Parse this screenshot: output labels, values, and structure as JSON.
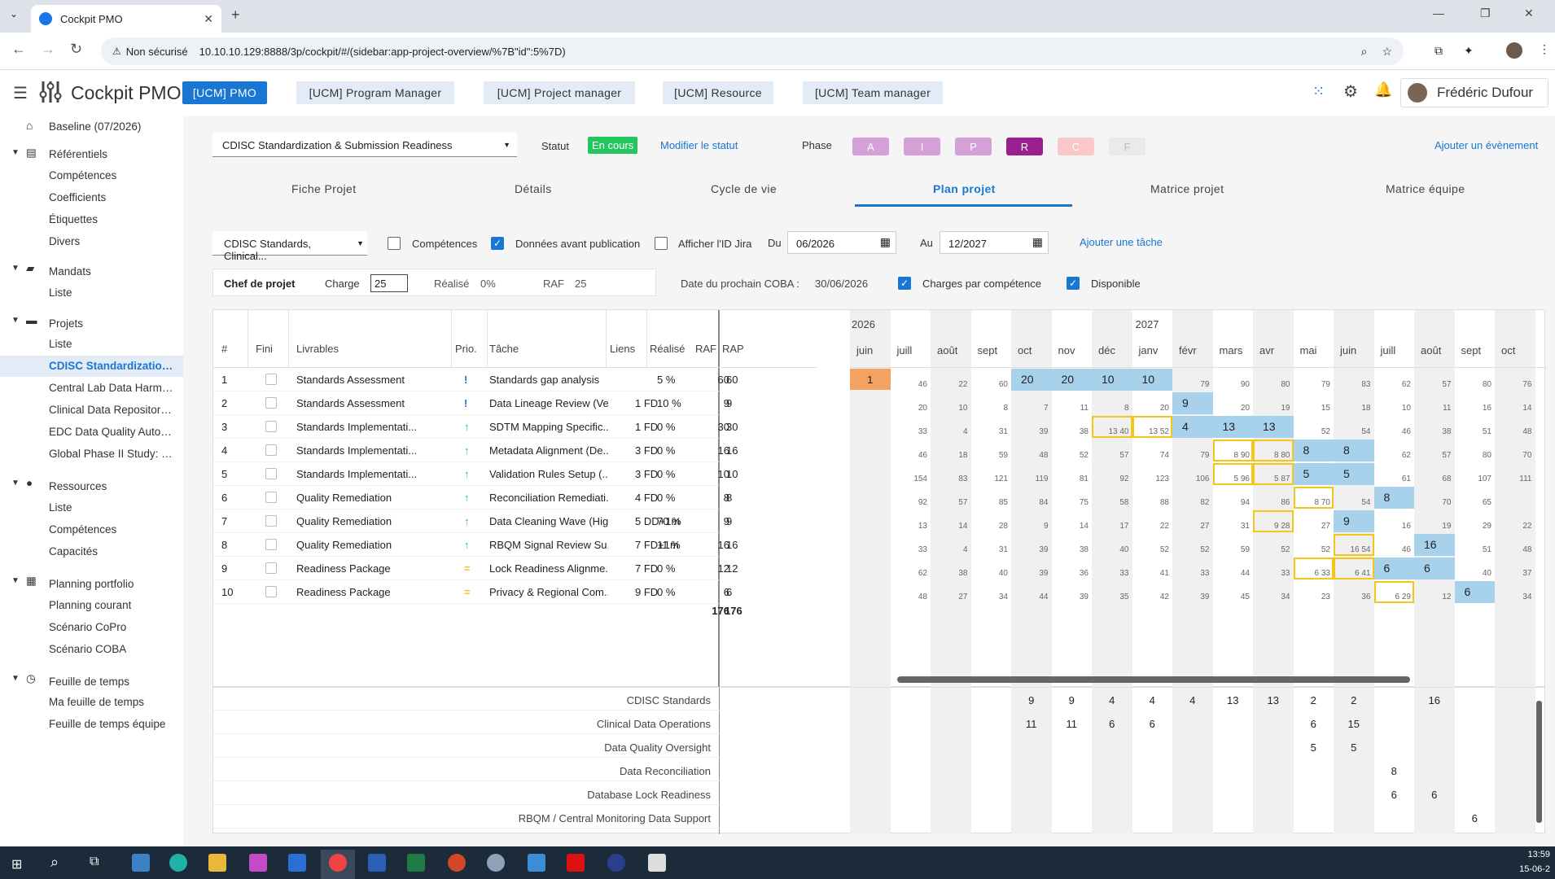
{
  "browser": {
    "tab_title": "Cockpit PMO",
    "security": "Non sécurisé",
    "url": "10.10.10.129:8888/3p/cockpit/#/(sidebar:app-project-overview/%7B\"id\":5%7D)"
  },
  "app": {
    "title": "Cockpit PMO",
    "user": "Frédéric Dufour",
    "roles": [
      "[UCM] PMO",
      "[UCM] Program Manager",
      "[UCM] Project manager",
      "[UCM] Resource",
      "[UCM] Team manager"
    ]
  },
  "sidebar": {
    "baseline": "Baseline (07/2026)",
    "sections": [
      {
        "title": "Référentiels",
        "items": [
          "Compétences",
          "Coefficients",
          "Étiquettes",
          "Divers"
        ]
      },
      {
        "title": "Mandats",
        "items": [
          "Liste"
        ]
      },
      {
        "title": "Projets",
        "items": [
          "Liste",
          "CDISC Standardization ...",
          "Central Lab Data Harmo...",
          "Clinical Data Repository ...",
          "EDC Data Quality Autom...",
          "Global Phase II Study: E..."
        ]
      },
      {
        "title": "Ressources",
        "items": [
          "Liste",
          "Compétences",
          "Capacités"
        ]
      },
      {
        "title": "Planning portfolio",
        "items": [
          "Planning courant",
          "Scénario CoPro",
          "Scénario COBA"
        ]
      },
      {
        "title": "Feuille de temps",
        "items": [
          "Ma feuille de temps",
          "Feuille de temps équipe"
        ]
      }
    ]
  },
  "project": {
    "name": "CDISC Standardization & Submission Readiness",
    "statut_label": "Statut",
    "statut": "En cours",
    "modify": "Modifier le statut",
    "phase_label": "Phase",
    "phases": [
      "A",
      "I",
      "P",
      "R",
      "C",
      "F"
    ],
    "add_event": "Ajouter un évènement"
  },
  "tabs": [
    "Fiche Projet",
    "Détails",
    "Cycle de vie",
    "Plan projet",
    "Matrice projet",
    "Matrice équipe"
  ],
  "filters": {
    "select": "CDISC Standards, Clinical...",
    "competences": "Compétences",
    "donnees": "Données avant publication",
    "jira": "Afficher l'ID Jira",
    "du": "Du",
    "du_val": "06/2026",
    "au": "Au",
    "au_val": "12/2027",
    "add_task": "Ajouter une tâche"
  },
  "summary": {
    "chef": "Chef de projet",
    "charge_label": "Charge",
    "charge": "25",
    "realise_label": "Réalisé",
    "realise": "0%",
    "raf_label": "RAF",
    "raf": "25",
    "coba_label": "Date du prochain COBA :",
    "coba": "30/06/2026",
    "charges_comp": "Charges par compétence",
    "disponible": "Disponible"
  },
  "grid": {
    "headers": [
      "#",
      "Fini",
      "Livrables",
      "Prio.",
      "Tâche",
      "Liens",
      "Réalisé",
      "RAF",
      "RAP"
    ],
    "years": [
      "2026",
      "2027"
    ],
    "months": [
      "juin",
      "juill",
      "août",
      "sept",
      "oct",
      "nov",
      "déc",
      "janv",
      "févr",
      "mars",
      "avr",
      "mai",
      "juin",
      "juill",
      "août",
      "sept",
      "oct"
    ],
    "rows": [
      {
        "n": "1",
        "liv": "Standards Assessment",
        "tache": "Standards gap analysis",
        "liens": "",
        "real": "5 %",
        "raf": "60",
        "rap": "60"
      },
      {
        "n": "2",
        "liv": "Standards Assessment",
        "tache": "Data Lineage Review (Ve...",
        "liens": "1 FD",
        "real": "10 %",
        "raf": "9",
        "rap": "9"
      },
      {
        "n": "3",
        "liv": "Standards Implementati...",
        "tache": "SDTM Mapping Specific...",
        "liens": "1 FD",
        "real": "0 %",
        "raf": "30",
        "rap": "30"
      },
      {
        "n": "4",
        "liv": "Standards Implementati...",
        "tache": "Metadata Alignment (De...",
        "liens": "3 FD",
        "real": "0 %",
        "raf": "16",
        "rap": "16"
      },
      {
        "n": "5",
        "liv": "Standards Implementati...",
        "tache": "Validation Rules Setup (...",
        "liens": "3 FD",
        "real": "0 %",
        "raf": "10",
        "rap": "10"
      },
      {
        "n": "6",
        "liv": "Quality Remediation",
        "tache": "Reconciliation Remediati...",
        "liens": "4 FD",
        "real": "0 %",
        "raf": "8",
        "rap": "8"
      },
      {
        "n": "7",
        "liv": "Quality Remediation",
        "tache": "Data Cleaning Wave (Hig...",
        "liens": "5 DD+1m",
        "real": "70 %",
        "raf": "9",
        "rap": "9"
      },
      {
        "n": "8",
        "liv": "Quality Remediation",
        "tache": "RBQM Signal Review Su...",
        "liens": "7 FD+1m",
        "real": "11 %",
        "raf": "16",
        "rap": "16"
      },
      {
        "n": "9",
        "liv": "Readiness Package",
        "tache": "Lock Readiness Alignme...",
        "liens": "7 FD",
        "real": "0 %",
        "raf": "12",
        "rap": "12"
      },
      {
        "n": "10",
        "liv": "Readiness Package",
        "tache": "Privacy & Regional Com...",
        "liens": "9 FD",
        "real": "0 %",
        "raf": "6",
        "rap": "6"
      }
    ],
    "totals": {
      "raf": "176",
      "rap": "176"
    },
    "cal": [
      [
        "46",
        "22",
        "60",
        "20 77",
        "20 74",
        "10 67",
        "10 84",
        "79",
        "90",
        "80",
        "79",
        "83",
        "62",
        "57",
        "80",
        "76"
      ],
      [
        "20",
        "10",
        "8",
        "7",
        "11",
        "8",
        "20",
        "18",
        "20",
        "19",
        "15",
        "18",
        "10",
        "11",
        "16",
        "14"
      ],
      [
        "33",
        "4",
        "31",
        "39",
        "38",
        "13 40",
        "13 52",
        "4 52",
        "52",
        "52",
        "52",
        "54",
        "46",
        "38",
        "51",
        "48"
      ],
      [
        "46",
        "18",
        "59",
        "48",
        "52",
        "57",
        "74",
        "79",
        "8 90",
        "8 80",
        "79",
        "83",
        "62",
        "57",
        "80",
        "70"
      ],
      [
        "154",
        "83",
        "121",
        "119",
        "81",
        "92",
        "123",
        "106",
        "5 96",
        "5 87",
        "115",
        "128",
        "61",
        "68",
        "107",
        "111"
      ],
      [
        "92",
        "57",
        "85",
        "84",
        "75",
        "58",
        "88",
        "82",
        "94",
        "86",
        "8 70",
        "54",
        "54",
        "70",
        "65",
        ""
      ],
      [
        "13",
        "14",
        "28",
        "9",
        "14",
        "17",
        "22",
        "27",
        "31",
        "9 28",
        "27",
        "29",
        "16",
        "19",
        "29",
        "22"
      ],
      [
        "33",
        "4",
        "31",
        "39",
        "38",
        "40",
        "52",
        "52",
        "59",
        "52",
        "52",
        "16 54",
        "46",
        "38",
        "51",
        "48"
      ],
      [
        "62",
        "38",
        "40",
        "39",
        "36",
        "33",
        "41",
        "33",
        "44",
        "33",
        "6 33",
        "6 41",
        "30",
        "28",
        "40",
        "37"
      ],
      [
        "48",
        "27",
        "34",
        "44",
        "39",
        "35",
        "42",
        "39",
        "45",
        "34",
        "23",
        "36",
        "6 29",
        "12",
        "36",
        "34"
      ]
    ]
  },
  "bottom": {
    "rows": [
      {
        "label": "CDISC Standards",
        "vals": [
          "",
          "",
          "",
          "",
          "9",
          "9",
          "4",
          "4",
          "4",
          "13",
          "13",
          "2",
          "2",
          "",
          "16",
          "",
          ""
        ]
      },
      {
        "label": "Clinical Data Operations",
        "vals": [
          "",
          "",
          "",
          "",
          "11",
          "11",
          "6",
          "6",
          "",
          "",
          "",
          "6",
          "15",
          "",
          "",
          "",
          ""
        ]
      },
      {
        "label": "Data Quality Oversight",
        "vals": [
          "",
          "",
          "",
          "",
          "",
          "",
          "",
          "",
          "",
          "",
          "",
          "5",
          "5",
          "",
          "",
          "",
          ""
        ]
      },
      {
        "label": "Data Reconciliation",
        "vals": [
          "",
          "",
          "",
          "",
          "",
          "",
          "",
          "",
          "",
          "",
          "",
          "",
          "",
          "8",
          "",
          "",
          ""
        ]
      },
      {
        "label": "Database Lock Readiness",
        "vals": [
          "",
          "",
          "",
          "",
          "",
          "",
          "",
          "",
          "",
          "",
          "",
          "",
          "",
          "6",
          "6",
          "",
          ""
        ]
      },
      {
        "label": "RBQM / Central Monitoring Data Support",
        "vals": [
          "",
          "",
          "",
          "",
          "",
          "",
          "",
          "",
          "",
          "",
          "",
          "",
          "",
          "",
          "",
          "6",
          ""
        ]
      }
    ]
  },
  "clock": {
    "time": "13:59",
    "date": "15-06-2"
  }
}
